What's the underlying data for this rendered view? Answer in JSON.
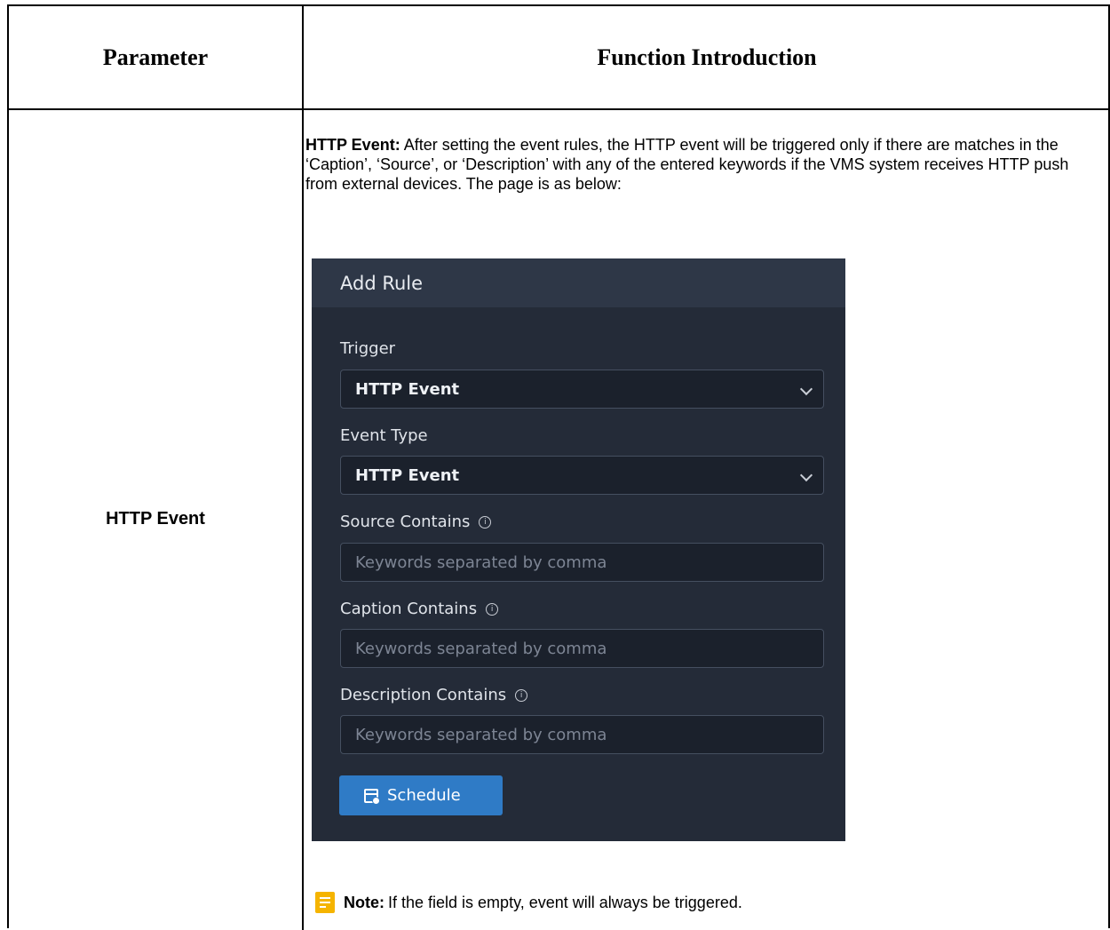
{
  "table": {
    "header_parameter": "Parameter",
    "header_function": "Function Introduction",
    "row_label": "HTTP Event"
  },
  "intro": {
    "lead": "HTTP Event:",
    "text": " After setting the event rules, the HTTP event will be triggered only if there are matches in the ‘Caption’, ‘Source’, or ‘Description’ with any of the entered keywords if the VMS system receives HTTP push from external devices. The page is as below:"
  },
  "dialog": {
    "title": "Add Rule",
    "trigger_label": "Trigger",
    "trigger_value": "HTTP Event",
    "event_type_label": "Event Type",
    "event_type_value": "HTTP Event",
    "source_label": "Source Contains",
    "source_placeholder": "Keywords separated by comma",
    "caption_label": "Caption Contains",
    "caption_placeholder": "Keywords separated by comma",
    "description_label": "Description Contains",
    "description_placeholder": "Keywords separated by comma",
    "schedule_label": "Schedule"
  },
  "note": {
    "lead": "Note:",
    "text": "If the field is empty, event will always be triggered."
  },
  "colors": {
    "dialog_bg": "#242b38",
    "dialog_title_bg": "#2e3747",
    "field_bg": "#1b212c",
    "button_blue": "#2f7bc6",
    "note_icon": "#f5b400"
  }
}
